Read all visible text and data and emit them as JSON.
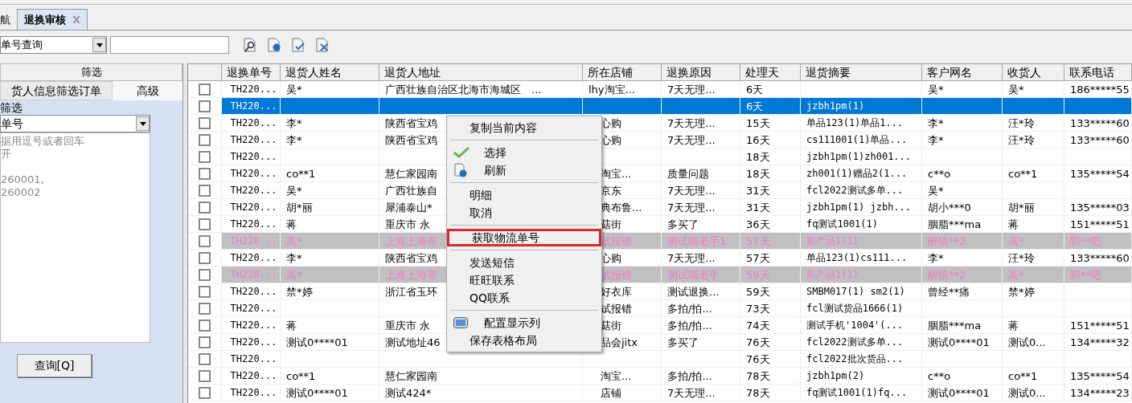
{
  "tabs": [
    {
      "label": "航",
      "selected": false,
      "closable": false
    },
    {
      "label": "退换审核",
      "selected": true,
      "closable": true,
      "close": "X"
    }
  ],
  "toolbar": {
    "query_type": "单号查询"
  },
  "left_panel": {
    "header": "筛选",
    "tabs": [
      {
        "label": "货人信息筛选订单",
        "selected": false
      },
      {
        "label": "高级",
        "selected": true
      }
    ],
    "group": "筛选",
    "field": "单号",
    "hint_lines": [
      "据用逗号或者回车",
      "开",
      "260001,",
      "260002"
    ],
    "button": "查询[Q]"
  },
  "table": {
    "columns": [
      "退换单号",
      "退货人姓名",
      "退货人地址",
      "所在店铺",
      "退换原因",
      "处理天",
      "退货摘要",
      "客户网名",
      "收货人",
      "联系电话"
    ],
    "rows": [
      {
        "checked": false,
        "selected": false,
        "flagged": false,
        "cells": [
          "TH220...",
          "吴*",
          "广西壮族自治区北海市海城区　...",
          "lhy淘宝...",
          "7天无理...",
          "6天",
          "",
          "吴*",
          "吴*",
          "186*****55"
        ]
      },
      {
        "checked": false,
        "selected": true,
        "flagged": false,
        "cells": [
          "TH220...",
          "",
          "",
          "",
          "",
          "6天",
          "jzbh1pm(1)",
          "",
          "",
          ""
        ]
      },
      {
        "checked": false,
        "selected": false,
        "flagged": false,
        "cells": [
          "TH220...",
          "李*",
          "陕西省宝鸡",
          "心购",
          "7天无理...",
          "15天",
          "单品123(1)单品1...",
          "李*",
          "汪*玲",
          "133*****60"
        ]
      },
      {
        "checked": false,
        "selected": false,
        "flagged": false,
        "cells": [
          "TH220...",
          "李*",
          "陕西省宝鸡",
          "心购",
          "7天无理...",
          "16天",
          "cs111001(1)单品...",
          "李*",
          "汪*玲",
          "133*****60"
        ]
      },
      {
        "checked": false,
        "selected": false,
        "flagged": false,
        "cells": [
          "TH220...",
          "",
          "",
          "",
          "",
          "18天",
          "jzbh1pm(1)zh001...",
          "",
          "",
          ""
        ]
      },
      {
        "checked": false,
        "selected": false,
        "flagged": false,
        "cells": [
          "TH220...",
          "co**1",
          "慧仁家园南",
          "淘宝...",
          "质量问题",
          "18天",
          "zh001(1)赠品2(1...",
          "c**o",
          "co**1",
          "135*****54"
        ]
      },
      {
        "checked": false,
        "selected": false,
        "flagged": false,
        "cells": [
          "TH220...",
          "吴*",
          "广西壮族自",
          "京东",
          "7天无理...",
          "31天",
          "fcl2022测试多单...",
          "吴*",
          "",
          ""
        ]
      },
      {
        "checked": false,
        "selected": false,
        "flagged": false,
        "cells": [
          "TH220...",
          "胡*丽",
          "犀浦泰山*",
          "典布鲁...",
          "7天无理...",
          "31天",
          "jzbh1pm(1) jzbh...",
          "胡小***0",
          "胡*丽",
          "135*****03"
        ]
      },
      {
        "checked": false,
        "selected": false,
        "flagged": false,
        "cells": [
          "TH220...",
          "蒋",
          "重庆市 永",
          "菇街",
          "多买了",
          "36天",
          "fq测试1001(1)",
          "胭脂***ma",
          "蒋",
          "151*****51"
        ]
      },
      {
        "checked": false,
        "selected": false,
        "flagged": true,
        "cells": [
          "TH220...",
          "高*",
          "上海上海市",
          "试报错",
          "测试哦老手1",
          "57天",
          "新产品1(1)",
          "醉狼**2",
          "高*",
          "郭**吧"
        ]
      },
      {
        "checked": false,
        "selected": false,
        "flagged": false,
        "cells": [
          "TH220...",
          "李*",
          "陕西省宝鸡",
          "心购",
          "7天无理...",
          "57天",
          "单品123(1)cs111...",
          "李*",
          "汪*玲",
          "133*****60"
        ]
      },
      {
        "checked": false,
        "selected": false,
        "flagged": true,
        "cells": [
          "TH220...",
          "高*",
          "上海上海市",
          "试报错",
          "测试哦老手",
          "59天",
          "新产品1(1)",
          "醉狼**2",
          "高*",
          "郭**吧"
        ]
      },
      {
        "checked": false,
        "selected": false,
        "flagged": false,
        "cells": [
          "TH220...",
          "禁*婷",
          "浙江省玉环",
          "好衣库",
          "测试退换...",
          "59天",
          "SMBM017(1) sm2(1)",
          "曾经**痛",
          "禁*婷",
          ""
        ]
      },
      {
        "checked": false,
        "selected": false,
        "flagged": false,
        "cells": [
          "TH220...",
          "",
          "",
          "试报错",
          "多拍/拍...",
          "73天",
          "fcl测试货品1666(1)",
          "",
          "",
          ""
        ]
      },
      {
        "checked": false,
        "selected": false,
        "flagged": false,
        "cells": [
          "TH220...",
          "蒋",
          "重庆市 永",
          "菇街",
          "多拍/拍...",
          "74天",
          "测试手机'1004'(...",
          "胭脂***ma",
          "蒋",
          "151*****51"
        ]
      },
      {
        "checked": false,
        "selected": false,
        "flagged": false,
        "cells": [
          "TH220...",
          "测试0****01",
          "测试地址46",
          "品会jitx",
          "多买了",
          "76天",
          "fcl2022测试多单...",
          "测试0****01",
          "测试0...",
          "134*****32"
        ]
      },
      {
        "checked": false,
        "selected": false,
        "flagged": false,
        "cells": [
          "TH220...",
          "",
          "",
          "",
          "",
          "76天",
          "fcl2022批次货品...",
          "",
          "",
          ""
        ]
      },
      {
        "checked": false,
        "selected": false,
        "flagged": false,
        "cells": [
          "TH220...",
          "co**1",
          "慧仁家园南",
          "淘宝...",
          "多拍/拍...",
          "78天",
          "jzbh1pm(2)",
          "c**o",
          "co**1",
          "135*****54"
        ]
      },
      {
        "checked": false,
        "selected": false,
        "flagged": false,
        "cells": [
          "TH220...",
          "测试0****01",
          "测试424*",
          "店铺",
          "7天无理...",
          "78天",
          "fq测试1001(1)fq...",
          "测试0****01",
          "测试0...",
          "134*****23"
        ]
      }
    ]
  },
  "context_menu": [
    {
      "kind": "item",
      "label": "复制当前内容",
      "highlighted": false
    },
    {
      "kind": "separator"
    },
    {
      "kind": "check_item",
      "label": "选择",
      "highlighted": false
    },
    {
      "kind": "globe_item",
      "label": "刷新",
      "highlighted": false
    },
    {
      "kind": "separator"
    },
    {
      "kind": "item",
      "label": "明细",
      "highlighted": false
    },
    {
      "kind": "item",
      "label": "取消",
      "highlighted": false
    },
    {
      "kind": "separator"
    },
    {
      "kind": "item",
      "label": "获取物流单号",
      "highlighted": true
    },
    {
      "kind": "separator"
    },
    {
      "kind": "item",
      "label": "发送短信",
      "highlighted": false
    },
    {
      "kind": "item",
      "label": "旺旺联系",
      "highlighted": false
    },
    {
      "kind": "item",
      "label": "QQ联系",
      "highlighted": false
    },
    {
      "kind": "separator"
    },
    {
      "kind": "monitor_item",
      "label": "配置显示列",
      "highlighted": false
    },
    {
      "kind": "item",
      "label": "保存表格布局",
      "highlighted": false
    }
  ]
}
